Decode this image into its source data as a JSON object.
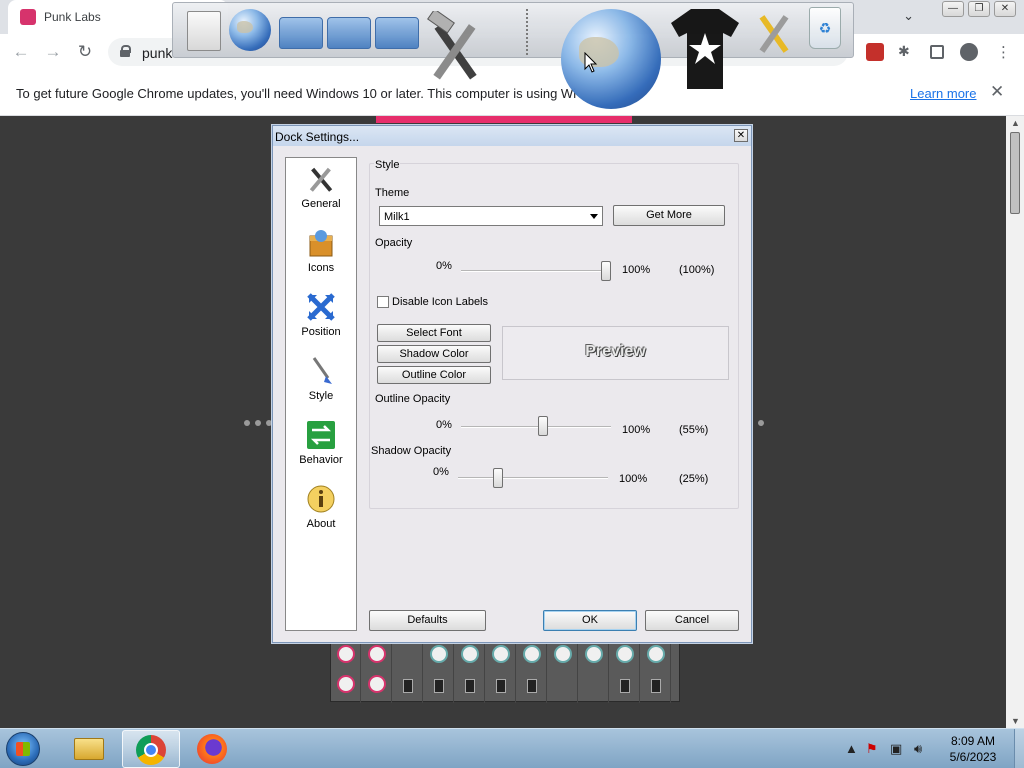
{
  "browser": {
    "tab_title": "Punk Labs",
    "url_visible": "punk",
    "info_bar_message": "To get future Google Chrome updates, you'll need Windows 10 or later. This computer is using Wi",
    "learn_more": "Learn more"
  },
  "dialog": {
    "title": "Dock Settings...",
    "nav": [
      {
        "label": "General",
        "icon": "tools-icon"
      },
      {
        "label": "Icons",
        "icon": "box-icon"
      },
      {
        "label": "Position",
        "icon": "arrows-icon"
      },
      {
        "label": "Style",
        "icon": "brush-icon"
      },
      {
        "label": "Behavior",
        "icon": "behavior-icon"
      },
      {
        "label": "About",
        "icon": "info-icon"
      }
    ],
    "style_group": "Style",
    "theme_label": "Theme",
    "theme_value": "Milk1",
    "get_more": "Get More",
    "opacity_label": "Opacity",
    "opacity_min": "0%",
    "opacity_max": "100%",
    "opacity_value": "(100%)",
    "opacity_pct": 100,
    "disable_labels": "Disable Icon Labels",
    "disable_labels_checked": false,
    "select_font": "Select Font",
    "shadow_color": "Shadow Color",
    "outline_color": "Outline Color",
    "preview": "Preview",
    "outline_opacity_label": "Outline Opacity",
    "outline_min": "0%",
    "outline_max": "100%",
    "outline_value": "(55%)",
    "outline_pct": 55,
    "shadow_opacity_label": "Shadow Opacity",
    "shadow_min": "0%",
    "shadow_max": "100%",
    "shadow_value": "(25%)",
    "shadow_pct": 25,
    "defaults": "Defaults",
    "ok": "OK",
    "cancel": "Cancel"
  },
  "taskbar": {
    "time": "8:09 AM",
    "date": "5/6/2023"
  }
}
